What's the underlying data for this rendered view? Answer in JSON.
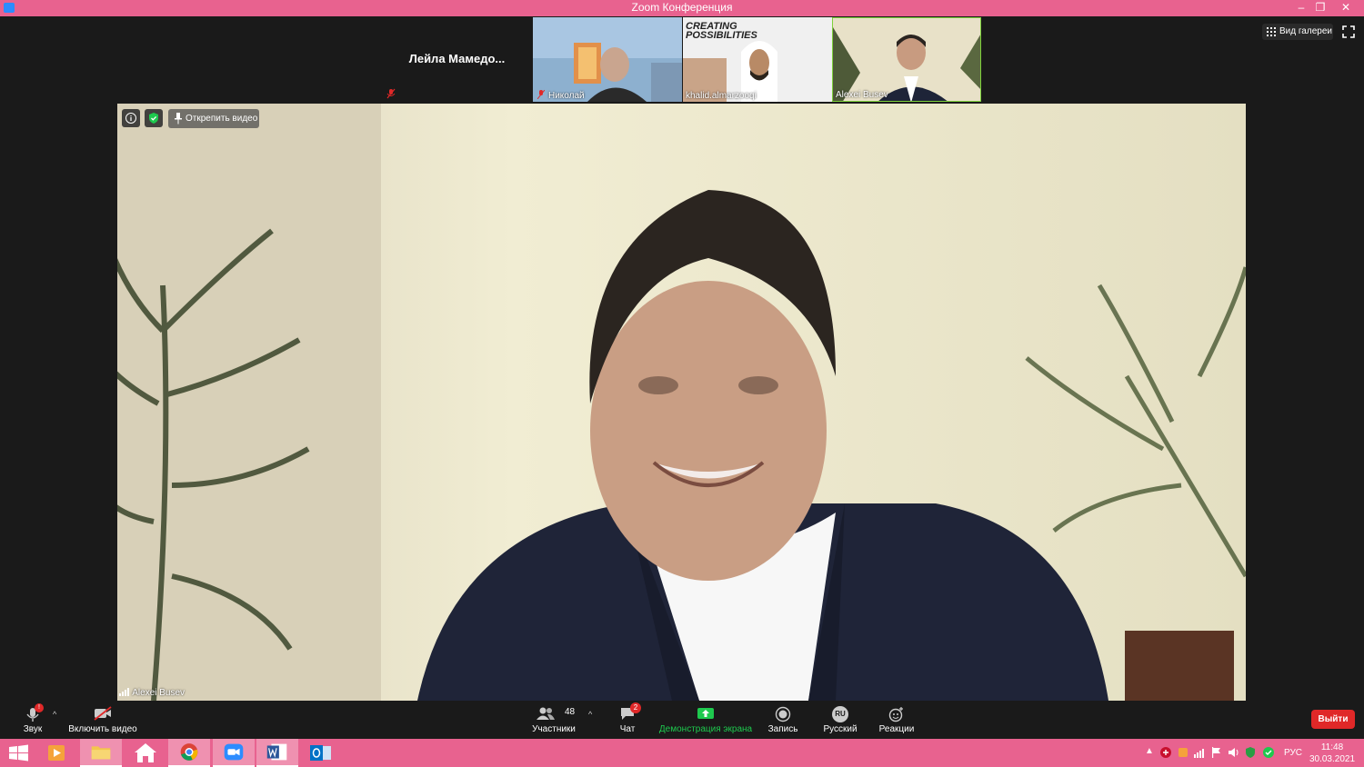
{
  "window": {
    "title": "Zoom Конференция",
    "minimize_glyph": "–",
    "restore_glyph": "❐",
    "close_glyph": "✕"
  },
  "participants_strip": {
    "name_only_tile": "Лейла  Мамедо...",
    "tiles": [
      {
        "name": "Николай",
        "muted": true
      },
      {
        "name": "khalid.almarzooqi",
        "muted": false,
        "banner": "CREATING POSSIBILITIES"
      },
      {
        "name": "Alexei Busev",
        "muted": false,
        "active_speaker": true
      }
    ]
  },
  "view_controls": {
    "gallery_label": "Вид галереи",
    "fullscreen_icon": "fullscreen-icon"
  },
  "main_video": {
    "speaker_name": "Alexei Busev",
    "unpin_label": "Открепить видео"
  },
  "toolbar": {
    "audio_label": "Звук",
    "video_label": "Включить видео",
    "participants_label": "Участники",
    "participants_count": "48",
    "chat_label": "Чат",
    "chat_badge": "2",
    "share_label": "Демонстрация экрана",
    "record_label": "Запись",
    "language_label": "Русский",
    "language_code": "RU",
    "reactions_label": "Реакции",
    "leave_label": "Выйти",
    "caret": "^"
  },
  "taskbar": {
    "language": "РУС",
    "time": "11:48",
    "date": "30.03.2021"
  },
  "colors": {
    "title_bar": "#e8628f",
    "taskbar": "#e8628f",
    "leave_button": "#e02828",
    "share_green": "#1ec94e",
    "active_speaker_border": "#7fd13b"
  }
}
